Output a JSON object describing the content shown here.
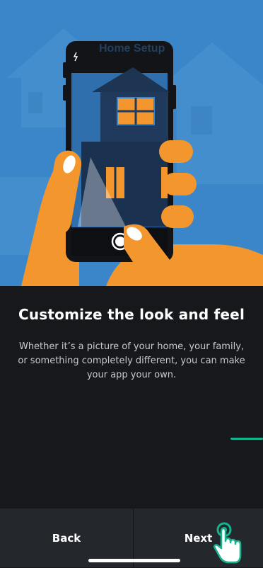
{
  "hero": {
    "phone_overlay_title": "Home Setup",
    "illustration": "hand-holding-phone-photographing-house"
  },
  "content": {
    "title": "Customize the look and feel",
    "body": "Whether it’s a picture of your home, your family, or something completely different, you can make your app your own."
  },
  "footer": {
    "back_label": "Back",
    "next_label": "Next"
  },
  "colors": {
    "accent": "#17b28f",
    "background": "#16181b",
    "footer": "#24272b",
    "hero_blue": "#3b85c8",
    "hand_orange": "#f2962d"
  },
  "icons": [
    "flash-icon",
    "shutter-button-icon",
    "tap-pointer-icon"
  ]
}
